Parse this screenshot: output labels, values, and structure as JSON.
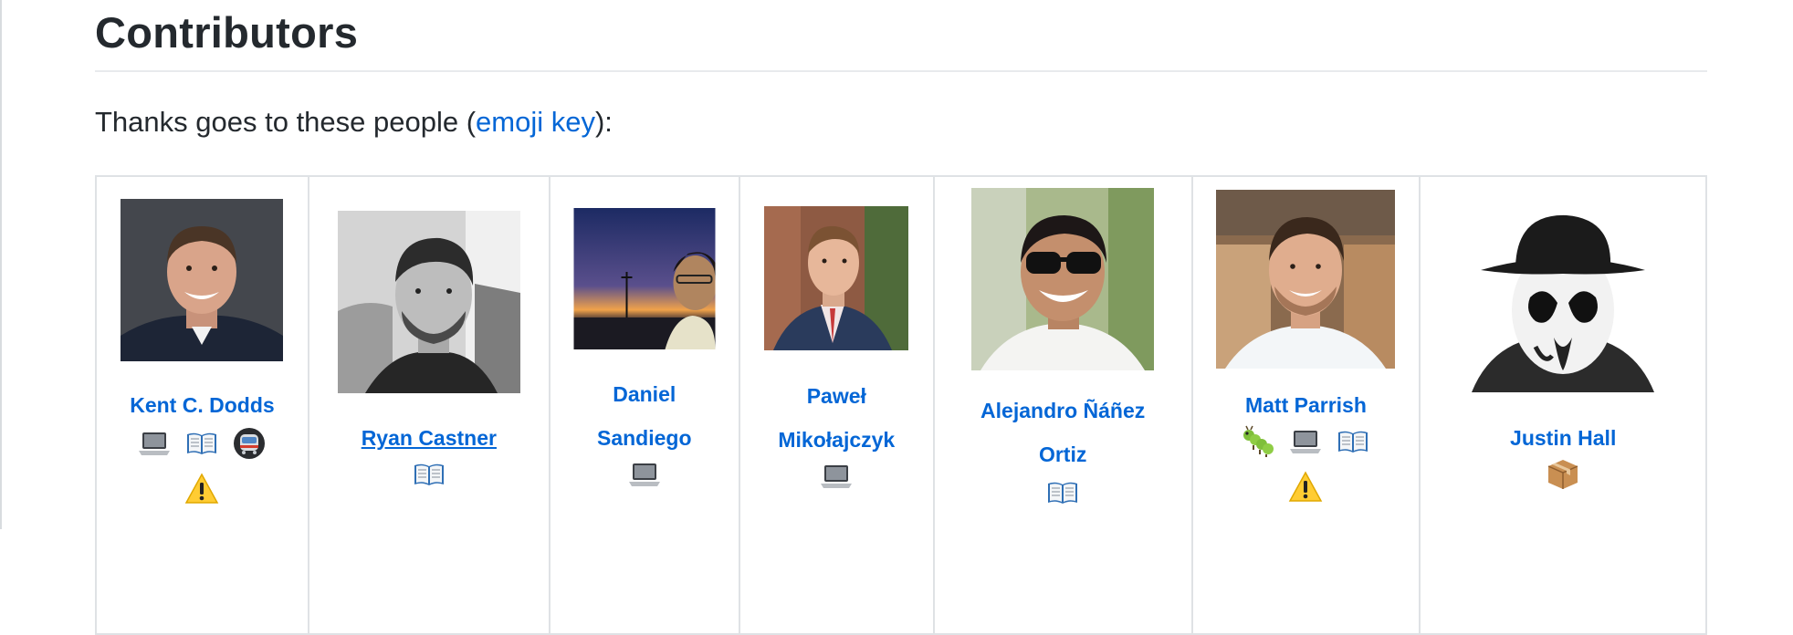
{
  "section": {
    "title": "Contributors",
    "intro_prefix": "Thanks goes to these people (",
    "intro_link": "emoji key",
    "intro_suffix": "):"
  },
  "colors": {
    "link": "#0366d6",
    "text": "#24292e",
    "border": "#dfe2e5"
  },
  "contributors": [
    {
      "name": "Kent C. Dodds",
      "contributions": [
        "laptop-icon",
        "book-icon",
        "metro-icon",
        "warning-icon"
      ]
    },
    {
      "name": "Ryan Castner",
      "contributions": [
        "book-icon"
      ]
    },
    {
      "name_line1": "Daniel",
      "name_line2": "Sandiego",
      "contributions": [
        "laptop-icon"
      ]
    },
    {
      "name_line1": "Paweł",
      "name_line2": "Mikołajczyk",
      "contributions": [
        "laptop-icon"
      ]
    },
    {
      "name_line1": "Alejandro Ñáñez",
      "name_line2": "Ortiz",
      "contributions": [
        "book-icon"
      ]
    },
    {
      "name": "Matt Parrish",
      "contributions": [
        "bug-icon",
        "laptop-icon",
        "book-icon",
        "warning-icon"
      ]
    },
    {
      "name": "Justin Hall",
      "contributions": [
        "package-icon"
      ]
    }
  ]
}
